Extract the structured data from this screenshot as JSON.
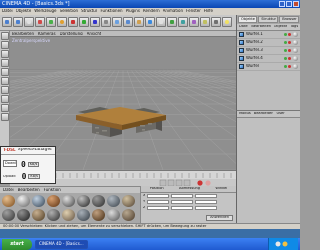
{
  "window": {
    "title": "CINEMA 4D - [Basics.3ds *]"
  },
  "menu": {
    "items": [
      "Datei",
      "Objekte",
      "Werkzeuge",
      "Selektion",
      "Struktur",
      "Funktionen",
      "Plugins",
      "Rendern",
      "Animation",
      "Fenster",
      "Hilfe"
    ]
  },
  "viewport": {
    "menu": [
      "Bearbeiten",
      "Kameras",
      "Darstellung",
      "Ansicht"
    ],
    "label": "Zentralperspektive"
  },
  "objects_panel": {
    "tabs": [
      "Objekte",
      "Struktur",
      "Browser"
    ],
    "menu": [
      "Datei",
      "Bearbeiten",
      "Objekte",
      "Tags"
    ],
    "rows": [
      {
        "name": "Würfel.1"
      },
      {
        "name": "Würfel.2"
      },
      {
        "name": "Würfel.3"
      },
      {
        "name": "Würfel.4"
      },
      {
        "name": "Würfel"
      }
    ]
  },
  "attributes_panel": {
    "menu": [
      "Modus",
      "Bearbeiten",
      "User"
    ]
  },
  "speed_manager": {
    "logo": "T-DSL",
    "title": "SpeedManager",
    "download_label": "Download",
    "download_value": "0",
    "upload_label": "Upload",
    "upload_value": "0",
    "unit": "KB/s"
  },
  "material_manager": {
    "menu": [
      "Datei",
      "Bearbeiten",
      "Funktion"
    ]
  },
  "coordinates": {
    "headers": [
      "Position",
      "Abmessung",
      "Winkel"
    ],
    "rows": [
      "X",
      "Y",
      "Z"
    ],
    "apply_label": "Anwenden"
  },
  "status": {
    "text": "00:00:00  Verschieben: Klicken und ziehen, um Elemente zu verschieben. SHIFT drücken, um Bewegung zu raster"
  },
  "taskbar": {
    "start_label": "start",
    "items": [
      "CINEMA 4D - [Basics..."
    ]
  }
}
